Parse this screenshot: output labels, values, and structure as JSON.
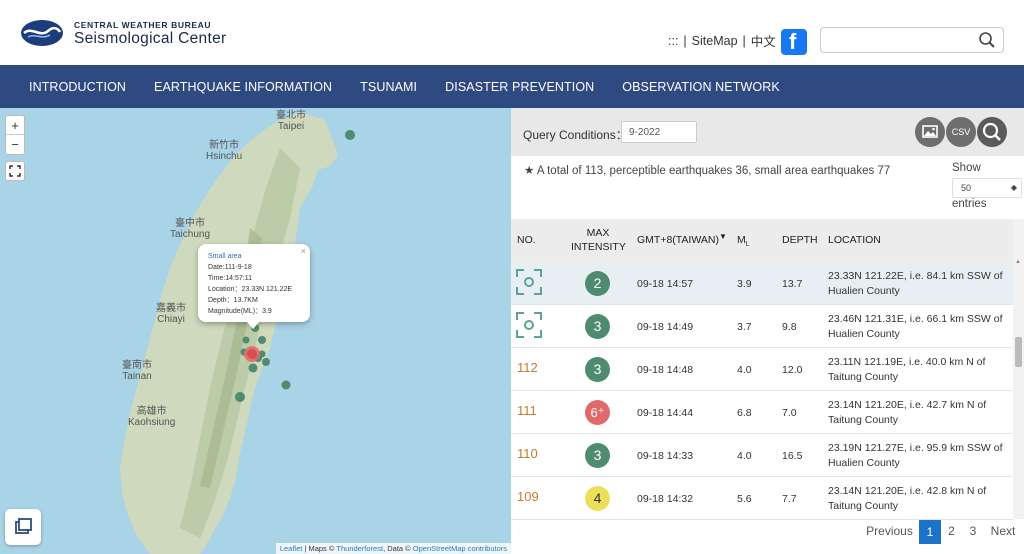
{
  "header": {
    "brand_small": "CENTRAL WEATHER BUREAU",
    "brand_big": "Seismological Center",
    "links": [
      ":::",
      "|",
      "SiteMap",
      "|",
      "中文",
      "|"
    ],
    "search_placeholder": ""
  },
  "nav": [
    "INTRODUCTION",
    "EARTHQUAKE INFORMATION",
    "TSUNAMI",
    "DISASTER PREVENTION",
    "OBSERVATION NETWORK"
  ],
  "map": {
    "cities": [
      {
        "zh": "臺北市",
        "en": "Taipei"
      },
      {
        "zh": "新竹市",
        "en": "Hsinchu"
      },
      {
        "zh": "臺中市",
        "en": "Taichung"
      },
      {
        "zh": "嘉義市",
        "en": "Chiayi"
      },
      {
        "zh": "臺南市",
        "en": "Tainan"
      },
      {
        "zh": "高雄市",
        "en": "Kaohsiung"
      }
    ],
    "zoom_in": "+",
    "zoom_out": "−",
    "popup": {
      "title": "Small area",
      "date": "Date:111-9-18",
      "time": "Time:14:57:11",
      "location": "Location：23.33N 121.22E",
      "depth": "Depth：13.7KM",
      "magnitude": "Magnitude(ML)：3.9",
      "close": "×"
    },
    "attribution": {
      "leaflet": "Leaflet",
      "maps_prefix": " | Maps © ",
      "thunderforest": "Thunderforest",
      "data_prefix": ", Data © ",
      "osm": "OpenStreetMap contributors"
    }
  },
  "query": {
    "label": "Query Conditions：",
    "value": "9-2022",
    "csv_label": "CSV"
  },
  "summary": "A total of 113, perceptible earthquakes 36, small area earthquakes 77",
  "entries": {
    "show": "Show",
    "value": "50",
    "label": "entries"
  },
  "table": {
    "headers": {
      "no": "NO.",
      "intensity_line1": "MAX",
      "intensity_line2": "INTENSITY",
      "time": "GMT+8(TAIWAN)",
      "ml": "M",
      "ml_sub": "L",
      "depth": "DEPTH",
      "location": "LOCATION"
    },
    "rows": [
      {
        "no": "",
        "intensity": "2",
        "color": "#4e8b6f",
        "time": "09-18 14:57",
        "ml": "3.9",
        "depth": "13.7",
        "loc": "23.33N 121.22E, i.e. 84.1 km SSW of Hualien County"
      },
      {
        "no": "",
        "intensity": "3",
        "color": "#4e8b6f",
        "time": "09-18 14:49",
        "ml": "3.7",
        "depth": "9.8",
        "loc": "23.46N 121.31E, i.e. 66.1 km SSW of Hualien County"
      },
      {
        "no": "112",
        "intensity": "3",
        "color": "#4e8b6f",
        "time": "09-18 14:48",
        "ml": "4.0",
        "depth": "12.0",
        "loc": "23.11N 121.19E, i.e. 40.0 km N of Taitung County"
      },
      {
        "no": "111",
        "intensity": "6⁺",
        "color": "#e06a6a",
        "time": "09-18 14:44",
        "ml": "6.8",
        "depth": "7.0",
        "loc": "23.14N 121.20E, i.e. 42.7 km N of Taitung County"
      },
      {
        "no": "110",
        "intensity": "3",
        "color": "#4e8b6f",
        "time": "09-18 14:33",
        "ml": "4.0",
        "depth": "16.5",
        "loc": "23.19N 121.27E, i.e. 95.9 km SSW of Hualien County"
      },
      {
        "no": "109",
        "intensity": "4",
        "color": "#ece05a",
        "time": "09-18 14:32",
        "ml": "5.6",
        "depth": "7.7",
        "loc": "23.14N 121.20E, i.e. 42.8 km N of Taitung County"
      }
    ]
  },
  "pager": {
    "previous": "Previous",
    "pages": [
      "1",
      "2",
      "3"
    ],
    "active": "1",
    "next": "Next"
  }
}
